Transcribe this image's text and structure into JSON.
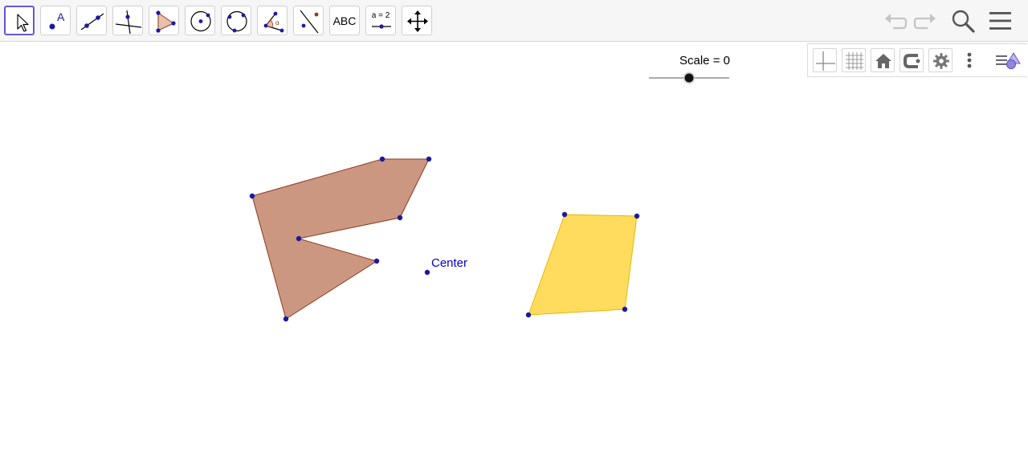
{
  "toolbar": {
    "tools": [
      {
        "name": "move-tool"
      },
      {
        "name": "point-tool",
        "glyph": "A"
      },
      {
        "name": "line-tool"
      },
      {
        "name": "perpendicular-line-tool"
      },
      {
        "name": "polygon-tool"
      },
      {
        "name": "circle-center-point-tool"
      },
      {
        "name": "circle-three-points-tool"
      },
      {
        "name": "angle-tool",
        "glyph": "α"
      },
      {
        "name": "reflect-about-line-tool"
      },
      {
        "name": "text-tool",
        "label": "ABC"
      },
      {
        "name": "slider-tool",
        "label": "a = 2"
      },
      {
        "name": "move-graphics-view-tool"
      }
    ],
    "right_icons": [
      "undo-icon",
      "redo-icon",
      "search-icon",
      "menu-icon"
    ]
  },
  "style_bar": {
    "icons": [
      "axes-toggle-icon",
      "grid-toggle-icon",
      "home-icon",
      "point-capturing-icon",
      "settings-gear-icon",
      "more-vertical-icon",
      "view-menu-icon"
    ]
  },
  "slider": {
    "label": "Scale = 0",
    "name": "Scale",
    "value": 0,
    "fraction": 0.5
  },
  "objects": {
    "center_point_label": "Center"
  },
  "colors": {
    "accent": "#6557d2",
    "polygon1_fill": "#c9917a",
    "polygon1_stroke": "#8b3a1e",
    "polygon2_fill": "#ffd84d",
    "polygon2_stroke": "#e6b800",
    "point": "#1a1aa0"
  }
}
